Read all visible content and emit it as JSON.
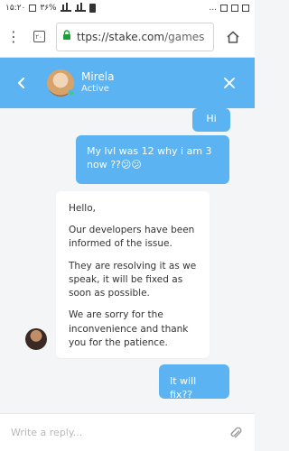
{
  "status_bar": {
    "time": "۱۵:۲۰",
    "battery_text": "۳۶%",
    "dots": "..."
  },
  "browser": {
    "url_main": "ttps://stake.com",
    "url_tail": "/games",
    "tabs_count": "۲۰"
  },
  "chat_header": {
    "agent_name": "Mirela",
    "agent_status": "Active"
  },
  "messages": [
    {
      "from": "user",
      "text": "Hi"
    },
    {
      "from": "user",
      "text": "My lvl was 12 why i am 3 now ??😕😕"
    },
    {
      "from": "agent",
      "paragraphs": [
        "Hello,",
        "Our developers have been informed of the issue.",
        "They are resolving it as we speak, it will be fixed as soon as possible.",
        "We are sorry for the inconvenience and thank you for the patience."
      ]
    },
    {
      "from": "user",
      "text": "It will fix??"
    }
  ],
  "composer": {
    "placeholder": "Write a reply..."
  },
  "icons": {
    "kebab": "more-vert-icon",
    "tabs": "tabs-icon",
    "lock": "lock-icon",
    "home": "home-icon",
    "back": "chevron-left-icon",
    "close": "close-icon",
    "attach": "paperclip-icon"
  },
  "colors": {
    "accent": "#5cb3f1",
    "presence": "#3ccf6b",
    "lock": "#1e9e3a"
  }
}
